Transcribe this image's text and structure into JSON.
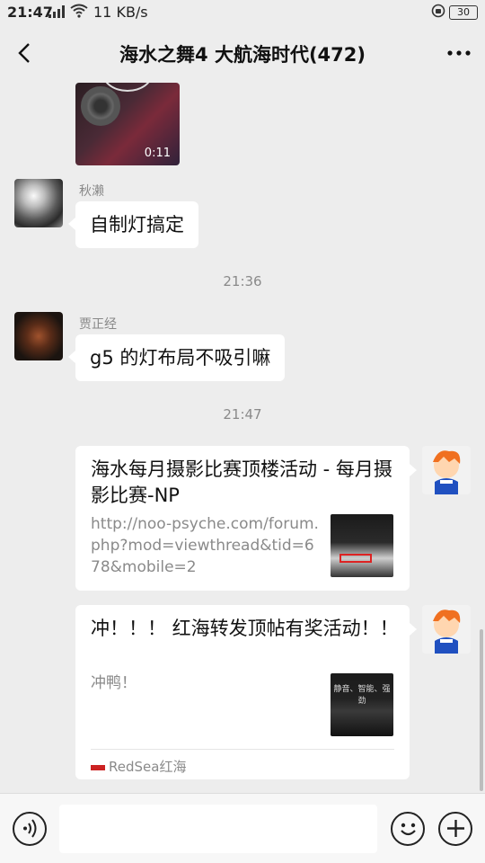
{
  "status_bar": {
    "time": "21:47",
    "network": "3G",
    "speed": "11 KB/s",
    "battery": "30"
  },
  "header": {
    "title": "海水之舞4 大航海时代(472)",
    "back_icon": "chevron-left-icon",
    "more_icon": "more-dots-icon"
  },
  "messages": [
    {
      "type": "video",
      "duration": "0:11"
    },
    {
      "type": "text",
      "sender": "秋濑",
      "text": "自制灯搞定"
    },
    {
      "type": "timestamp",
      "text": "21:36"
    },
    {
      "type": "text",
      "sender": "贾正经",
      "text": "g5 的灯布局不吸引嘛"
    },
    {
      "type": "timestamp",
      "text": "21:47"
    },
    {
      "type": "link_card",
      "title": "海水每月摄影比赛顶楼活动 - 每月摄影比赛-NP",
      "description": "http://noo-psyche.com/forum.php?mod=viewthread&tid=678&mobile=2"
    },
    {
      "type": "link_card",
      "title": "冲！！！ 红海转发顶帖有奖活动！！",
      "description": "冲鸭！",
      "thumb_text": "静音、智能、强劲",
      "source": "RedSea红海"
    }
  ],
  "input_bar": {
    "voice_icon": "voice-icon",
    "emoji_icon": "emoji-icon",
    "add_icon": "plus-icon",
    "placeholder": ""
  }
}
